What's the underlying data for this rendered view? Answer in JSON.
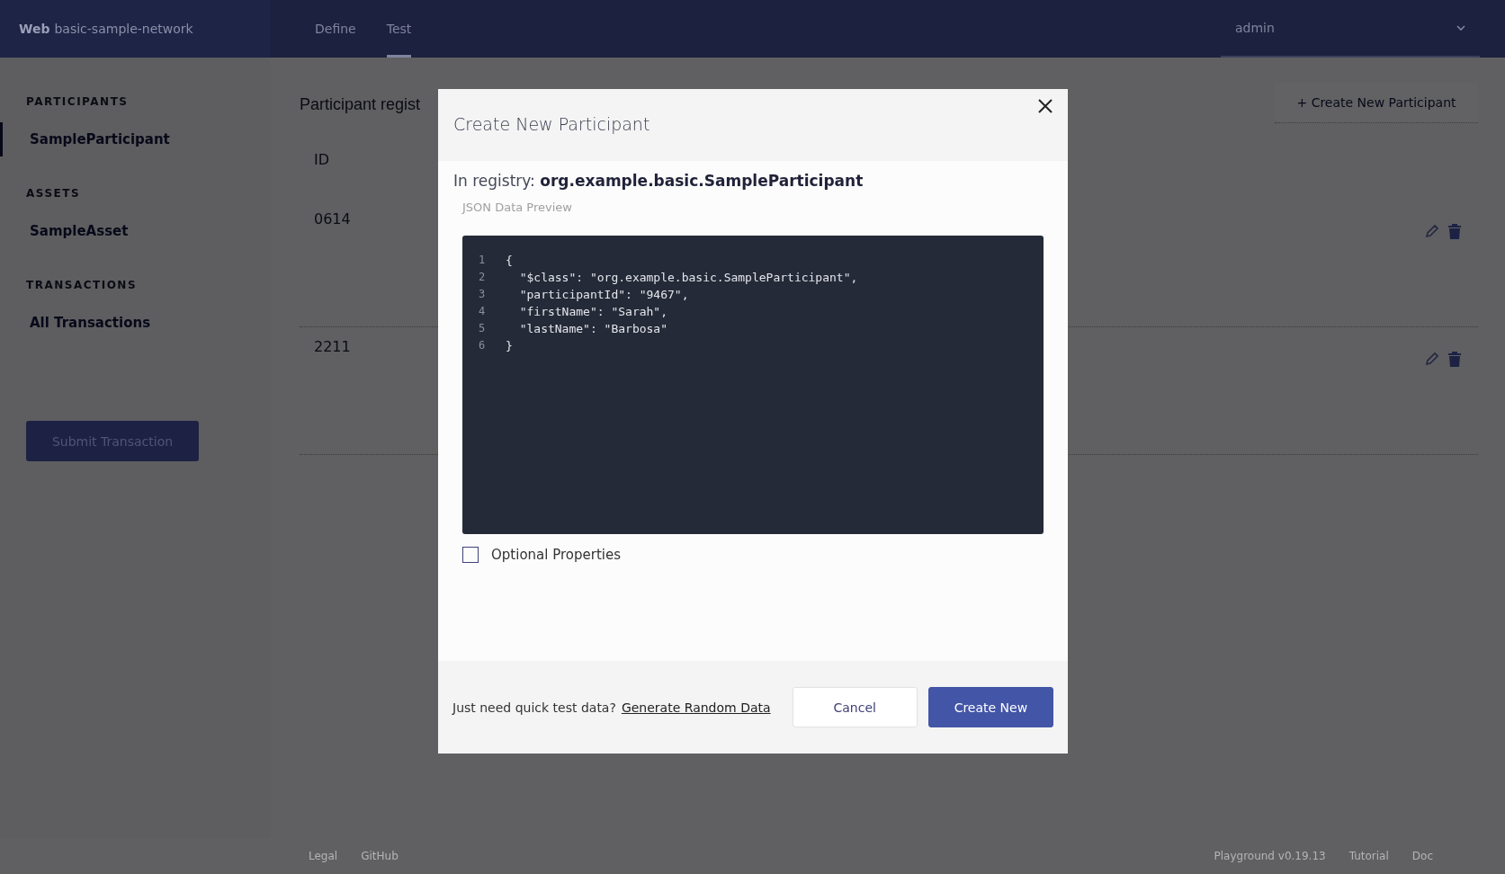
{
  "header": {
    "brand": "Web",
    "network": "basic-sample-network",
    "tabs": [
      {
        "label": "Define",
        "selected": false
      },
      {
        "label": "Test",
        "selected": true
      }
    ],
    "user": "admin"
  },
  "sidebar": {
    "sections": [
      {
        "heading": "PARTICIPANTS",
        "items": [
          {
            "label": "SampleParticipant",
            "selected": true
          }
        ]
      },
      {
        "heading": "ASSETS",
        "items": [
          {
            "label": "SampleAsset",
            "selected": false
          }
        ]
      },
      {
        "heading": "TRANSACTIONS",
        "items": [
          {
            "label": "All Transactions",
            "selected": false
          }
        ]
      }
    ],
    "submit_button": "Submit Transaction"
  },
  "main": {
    "title": "Participant regist",
    "create_button": "+ Create New Participant",
    "column": "ID",
    "rows": [
      {
        "id": "0614"
      },
      {
        "id": "2211"
      }
    ]
  },
  "footer": {
    "left_links": [
      "Legal",
      "GitHub"
    ],
    "right_links": [
      "Playground v0.19.13",
      "Tutorial",
      "Doc"
    ]
  },
  "modal": {
    "title": "Create New Participant",
    "registry": "In registry: **org.example.basic.SampleParticipant**",
    "preview_label": "JSON Data Preview",
    "code_lines": [
      {
        "number": "1",
        "text": "{"
      },
      {
        "number": "2",
        "text": "  \"$class\": \"org.example.basic.SampleParticipant\","
      },
      {
        "number": "3",
        "text": "  \"participantId\": \"9467\","
      },
      {
        "number": "4",
        "text": "  \"firstName\": \"Sarah\","
      },
      {
        "number": "5",
        "text": "  \"lastName\": \"Barbosa\""
      },
      {
        "number": "6",
        "text": "}"
      }
    ],
    "optional_properties": {
      "label": "Optional Properties",
      "checked": false
    },
    "hint": "Just need quick test data?",
    "random_link": "Generate Random Data",
    "cancel_button": "Cancel",
    "create_button": "Create New"
  }
}
